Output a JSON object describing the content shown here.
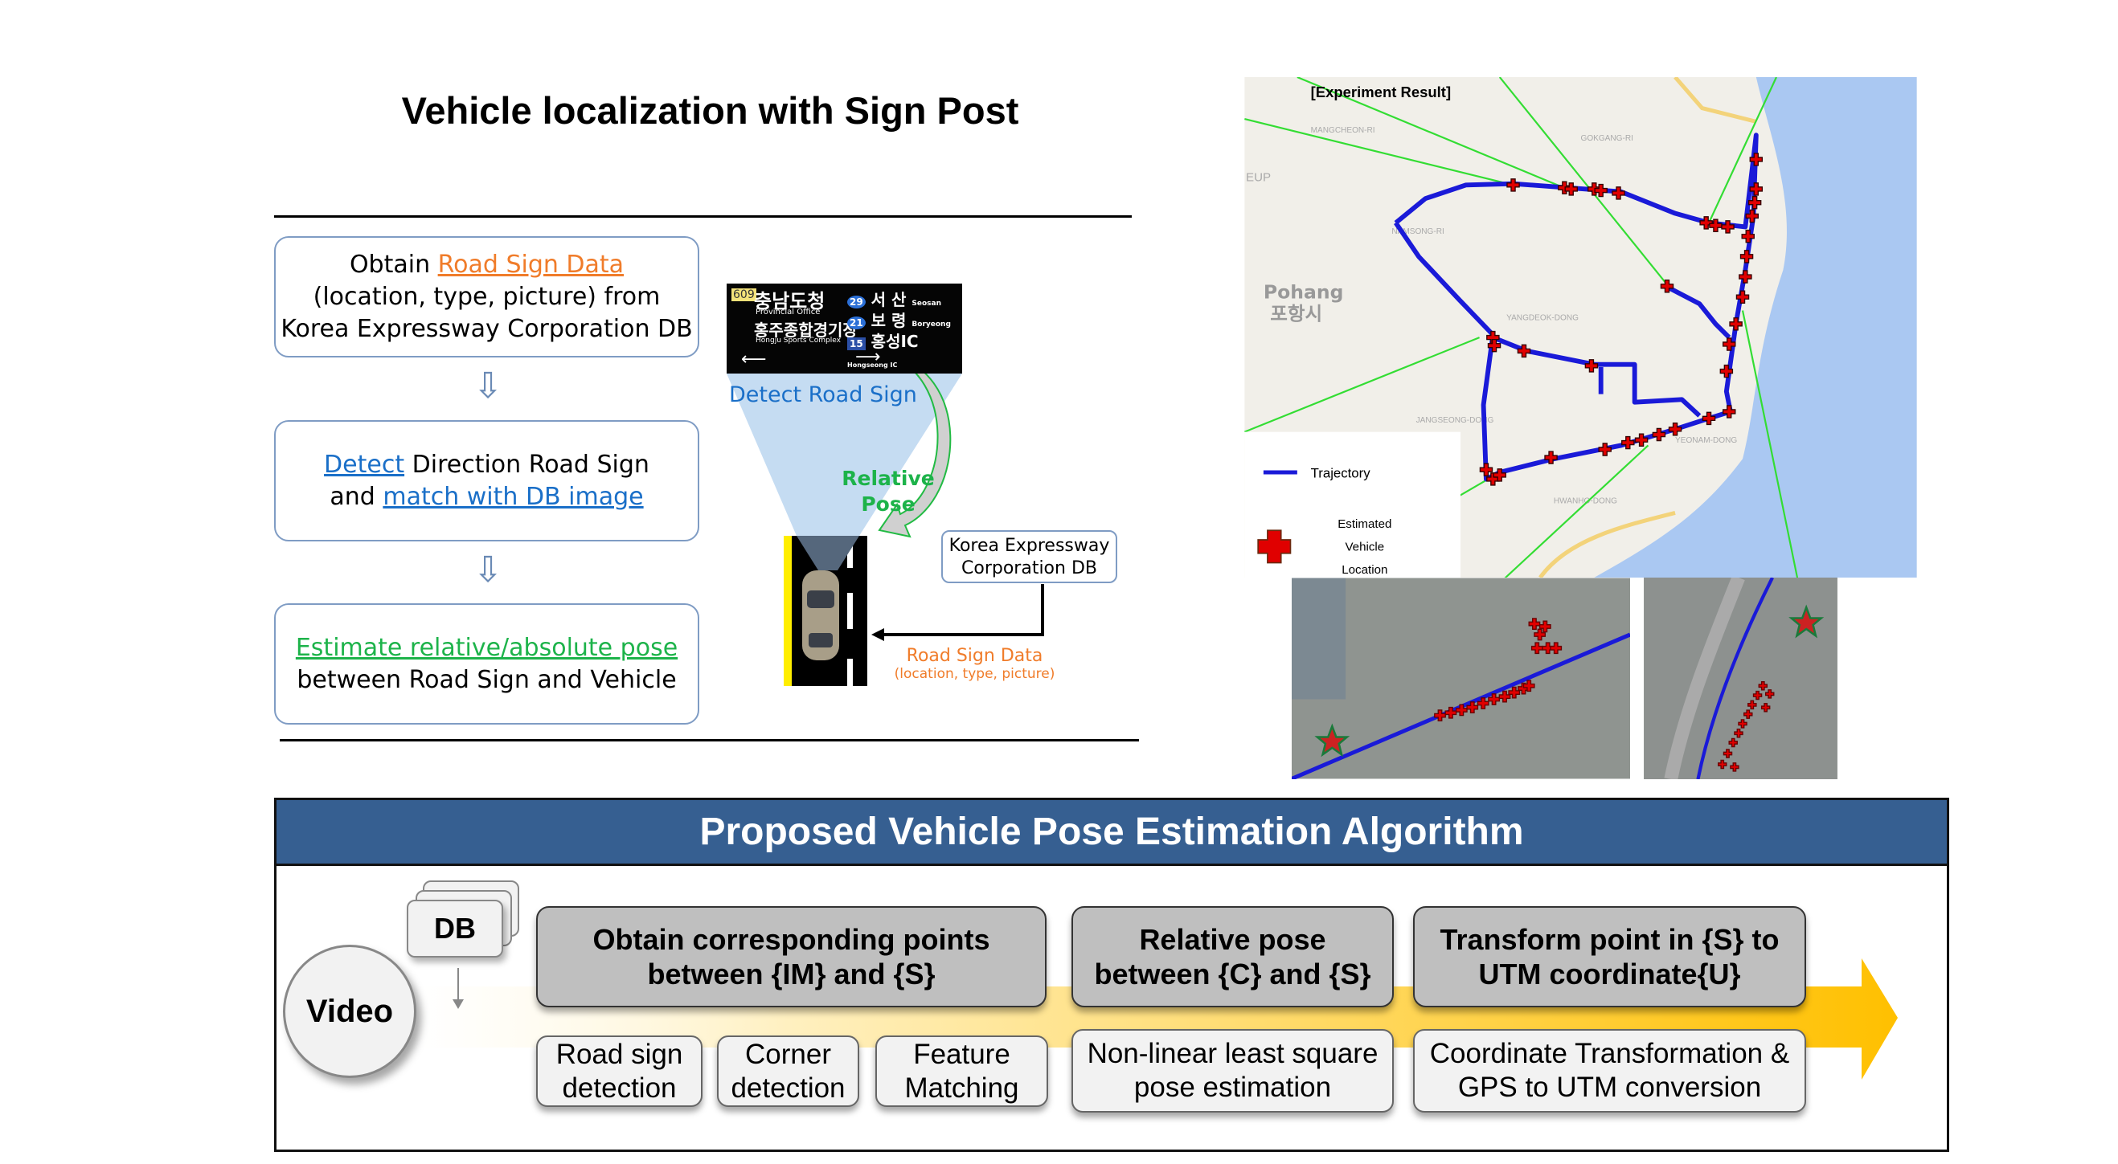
{
  "title": "Vehicle localization with Sign Post",
  "steps": [
    {
      "pre": "Obtain ",
      "link": "Road Sign Data",
      "line2": "(location, type, picture) from",
      "line3": "Korea Expressway Corporation DB"
    },
    {
      "link1": "Detect",
      "mid": " Direction Road Sign",
      "line2pre": "and ",
      "link2": "match with DB image"
    },
    {
      "link": "Estimate relative/absolute pose",
      "line2": "between Road Sign and Vehicle"
    }
  ],
  "sign": {
    "left": {
      "route": "609",
      "ko1": "충남도청",
      "en1": "Provincial Office",
      "ko2": "홍주종합경기장",
      "en2": "Hongju Sports Complex"
    },
    "right": [
      {
        "route": "29",
        "ko": "서 산",
        "en": "Seosan"
      },
      {
        "route": "21",
        "ko": "보 령",
        "en": "Boryeong"
      },
      {
        "route": "15",
        "ko": "홍성IC",
        "en": "Hongseong IC"
      }
    ]
  },
  "labels": {
    "detect": "Detect Road Sign",
    "relative1": "Relative",
    "relative2": "Pose",
    "db1": "Korea Expressway",
    "db2": "Corporation DB",
    "rsd": "Road Sign Data",
    "rsd2": "(location, type, picture)"
  },
  "map": {
    "title": "[Experiment Result]",
    "city": "Pohang",
    "city_ko": "포항시",
    "legend_traj": "Trajectory",
    "legend_est1": "Estimated",
    "legend_est2": "Vehicle",
    "legend_est3": "Location",
    "places": [
      "MANGCHEON-RI",
      "GOKGANG-RI",
      "NAMSONG-RI",
      "YANGDEOK-DONG",
      "JANGSEONG-DONG",
      "HWANHO-DONG",
      "YEONAM-DONG",
      "EUP"
    ],
    "colors": {
      "trajectory": "#1a1ad8",
      "estimate": "#e00000",
      "link": "#33dd33",
      "sea": "#aac8f2",
      "land": "#f1efe9"
    }
  },
  "pipeline": {
    "header": "Proposed Vehicle Pose Estimation Algorithm",
    "video": "Video",
    "db": "DB",
    "stages": [
      {
        "l1": "Obtain corresponding points",
        "l2": "between {IM} and {S}",
        "subs": [
          [
            "Road sign",
            "detection"
          ],
          [
            "Corner",
            "detection"
          ],
          [
            "Feature",
            "Matching"
          ]
        ]
      },
      {
        "l1": "Relative pose",
        "l2": "between {C} and {S}",
        "subs": [
          [
            "Non-linear least square",
            "pose estimation"
          ]
        ]
      },
      {
        "l1": "Transform point in {S} to",
        "l2": "UTM coordinate{U}",
        "subs": [
          [
            "Coordinate Transformation &",
            "GPS to UTM conversion"
          ]
        ]
      }
    ],
    "colors": {
      "header": "#365f91",
      "arrow": "#ffc000"
    }
  }
}
